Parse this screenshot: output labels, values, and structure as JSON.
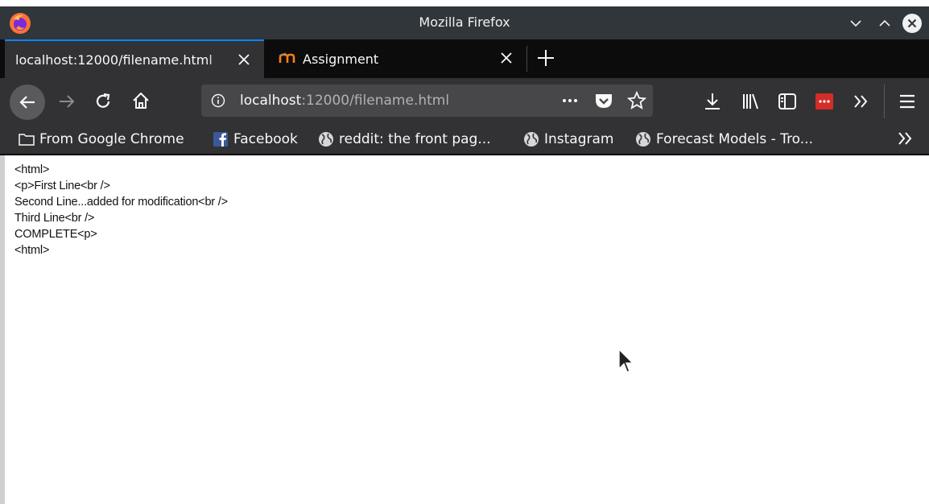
{
  "window": {
    "title": "Mozilla Firefox"
  },
  "tabs": [
    {
      "title": "localhost:12000/filename.html",
      "active": true
    },
    {
      "title": "Assignment",
      "active": false
    }
  ],
  "urlbar": {
    "host": "localhost",
    "path": ":12000/filename.html"
  },
  "bookmarks": [
    {
      "label": "From Google Chrome",
      "icon": "folder-icon"
    },
    {
      "label": "Facebook",
      "icon": "facebook-icon"
    },
    {
      "label": "reddit: the front pag...",
      "icon": "globe-icon"
    },
    {
      "label": "Instagram",
      "icon": "globe-icon"
    },
    {
      "label": "Forecast Models - Tro...",
      "icon": "globe-icon"
    }
  ],
  "page": {
    "lines": [
      "<html>",
      "<p>First Line<br />",
      "Second Line...added for modification<br />",
      "Third Line<br />",
      "COMPLETE<p>",
      "<html>"
    ]
  },
  "colors": {
    "accent": "#0a84ff",
    "titlebar": "#31363b",
    "toolbar": "#323234",
    "tabstrip": "#0c0c0d"
  }
}
